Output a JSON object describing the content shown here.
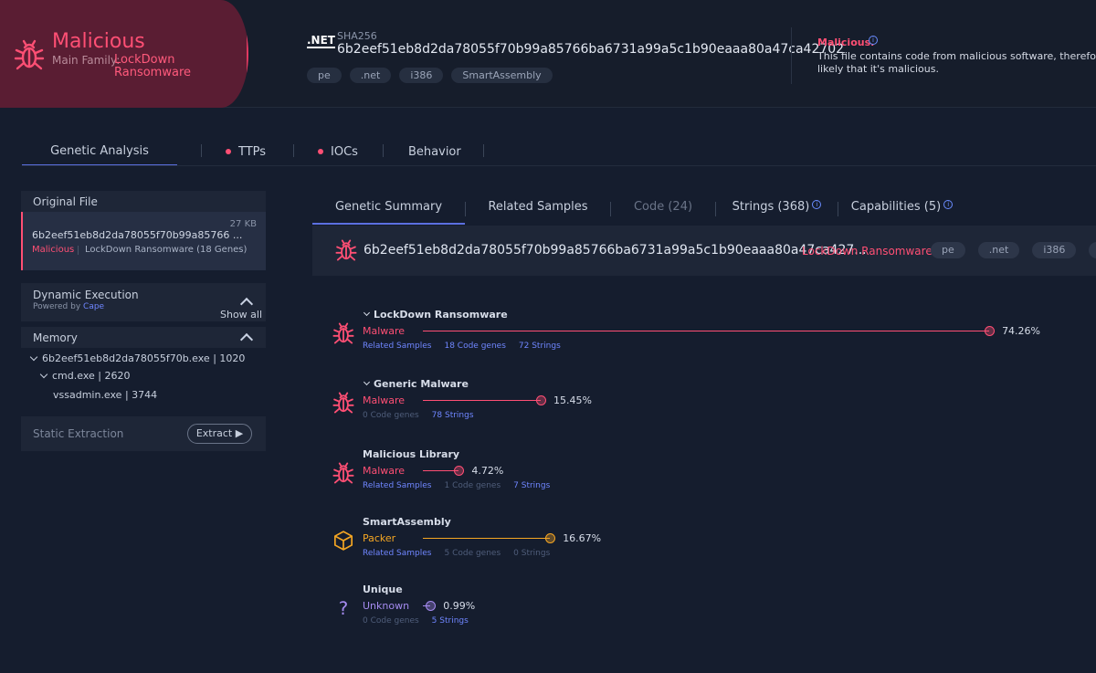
{
  "header": {
    "verdict": "Malicious",
    "family_label": "Main Family:",
    "family_name": "LockDown Ransomware",
    "net_logo": ".NET",
    "sha_label": "SHA256",
    "sha_value": "6b2eef51eb8d2da78055f70b99a85766ba6731a99a5c1b90eaaa80a47ca42702",
    "tags": [
      "pe",
      ".net",
      "i386",
      "SmartAssembly"
    ],
    "mal_title": "Malicious.",
    "mal_desc_line1": "This file contains code from malicious software, therefore i",
    "mal_desc_line2": "likely that it's malicious."
  },
  "main_tabs": [
    {
      "label": "Genetic Analysis"
    },
    {
      "label": "TTPs"
    },
    {
      "label": "IOCs"
    },
    {
      "label": "Behavior"
    }
  ],
  "sidebar": {
    "original_file_title": "Original File",
    "file_hash": "6b2eef51eb8d2da78055f70b99a85766 ...",
    "file_size": "27 KB",
    "file_verdict": "Malicious",
    "file_family": "LockDown Ransomware (18 Genes)",
    "dynamic_title": "Dynamic Execution",
    "powered_by": "Powered by",
    "powered_name": "Cape",
    "show_all": "Show all",
    "memory_title": "Memory",
    "tree": [
      {
        "label": "6b2eef51eb8d2da78055f70b.exe | 1020"
      },
      {
        "label": "cmd.exe | 2620"
      },
      {
        "label": "vssadmin.exe | 3744"
      }
    ],
    "static_title": "Static Extraction",
    "extract_label": "Extract ▶"
  },
  "sub_tabs": [
    {
      "label": "Genetic Summary"
    },
    {
      "label": "Related Samples"
    },
    {
      "label": "Code (24)"
    },
    {
      "label": "Strings (368)"
    },
    {
      "label": "Capabilities (5)"
    }
  ],
  "summary": {
    "hash": "6b2eef51eb8d2da78055f70b99a85766ba6731a99a5c1b90eaaa80a47ca427...",
    "family": "LockDown Ransomware",
    "tags": [
      "pe",
      ".net",
      "i386"
    ]
  },
  "genes": [
    {
      "name": "LockDown Ransomware",
      "class": "Malware",
      "percent": 74.26,
      "percent_label": "74.26%",
      "links": [
        "Related Samples",
        "18 Code genes",
        "72 Strings"
      ],
      "color": "#ff4f74"
    },
    {
      "name": "Generic Malware",
      "class": "Malware",
      "percent": 15.45,
      "percent_label": "15.45%",
      "links": [
        "0 Code genes",
        "78 Strings"
      ],
      "color": "#ff4f74"
    },
    {
      "name": "Malicious Library",
      "class": "Malware",
      "percent": 4.72,
      "percent_label": "4.72%",
      "links": [
        "Related Samples",
        "1 Code genes",
        "7 Strings"
      ],
      "color": "#ff4f74"
    },
    {
      "name": "SmartAssembly",
      "class": "Packer",
      "percent": 16.67,
      "percent_label": "16.67%",
      "links": [
        "Related Samples",
        "5 Code genes",
        "0 Strings"
      ],
      "color": "#f5a623"
    },
    {
      "name": "Unique",
      "class": "Unknown",
      "percent": 0.99,
      "percent_label": "0.99%",
      "links": [
        "0 Code genes",
        "5 Strings"
      ],
      "color": "#a58bf0"
    }
  ],
  "colors": {
    "malicious": "#ff4f74",
    "packer": "#f5a623",
    "unknown": "#a58bf0",
    "accent": "#5b6fe0"
  }
}
